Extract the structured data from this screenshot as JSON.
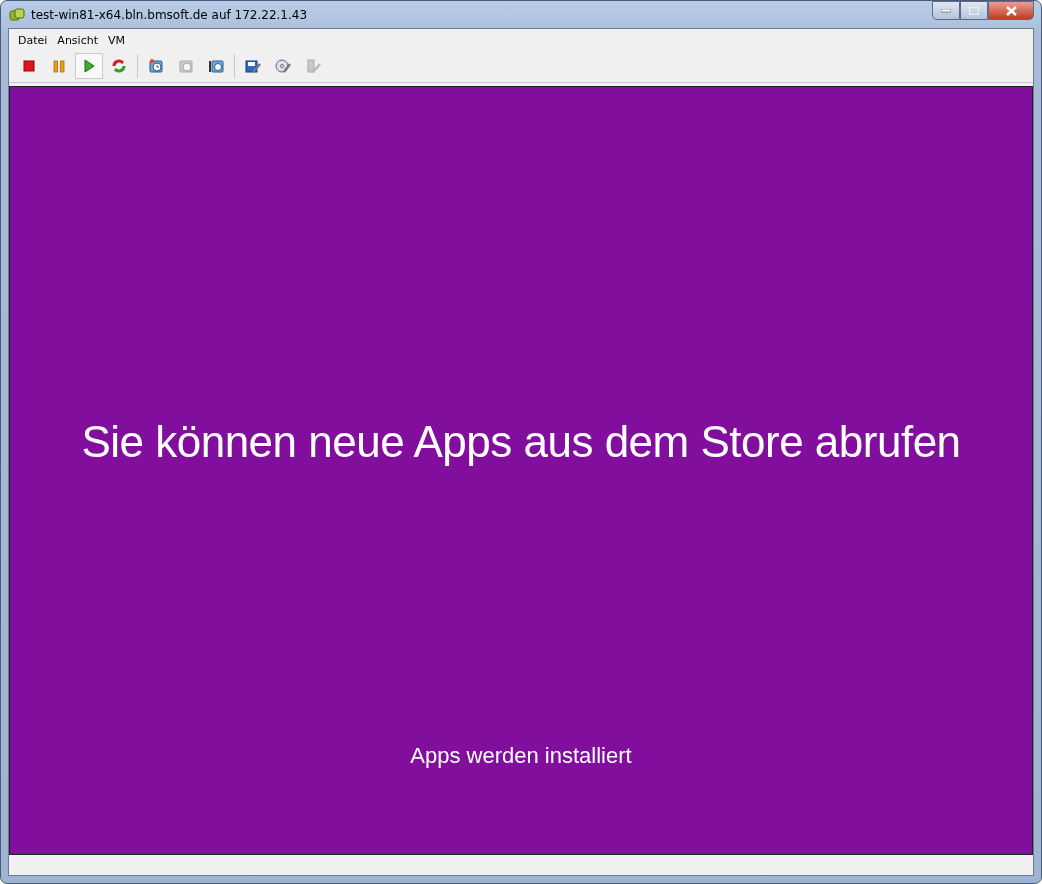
{
  "window": {
    "title": "test-win81-x64.bln.bmsoft.de auf 172.22.1.43"
  },
  "menu": [
    "Datei",
    "Ansicht",
    "VM"
  ],
  "toolbar": [
    {
      "kind": "stop",
      "pressed": false,
      "disabled": false
    },
    {
      "kind": "pause",
      "pressed": false,
      "disabled": false
    },
    {
      "kind": "play",
      "pressed": true,
      "disabled": false
    },
    {
      "kind": "reset",
      "pressed": false,
      "disabled": false
    },
    {
      "kind": "snapshot",
      "pressed": false,
      "disabled": false
    },
    {
      "kind": "revert",
      "pressed": false,
      "disabled": true
    },
    {
      "kind": "manage",
      "pressed": false,
      "disabled": false
    },
    {
      "kind": "settings",
      "pressed": false,
      "disabled": false
    },
    {
      "kind": "cd",
      "pressed": false,
      "disabled": false
    },
    {
      "kind": "usb",
      "pressed": false,
      "disabled": true
    }
  ],
  "console": {
    "heading": "Sie können neue Apps aus dem Store abrufen",
    "status": "Apps werden installiert"
  }
}
